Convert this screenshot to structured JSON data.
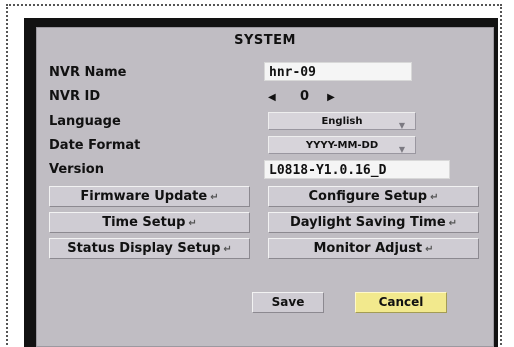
{
  "dialog": {
    "title": "SYSTEM"
  },
  "fields": {
    "nvr_name": {
      "label": "NVR Name",
      "value": "hnr-09"
    },
    "nvr_id": {
      "label": "NVR ID",
      "value": "0"
    },
    "language": {
      "label": "Language",
      "value": "English"
    },
    "date_format": {
      "label": "Date Format",
      "value": "YYYY-MM-DD"
    },
    "version": {
      "label": "Version",
      "value": "L0818-Y1.0.16_D"
    }
  },
  "buttons": {
    "firmware_update": "Firmware Update",
    "configure_setup": "Configure Setup",
    "time_setup": "Time Setup",
    "daylight_saving_time": "Daylight Saving Time",
    "status_display_setup": "Status Display Setup",
    "monitor_adjust": "Monitor Adjust",
    "save": "Save",
    "cancel": "Cancel"
  },
  "icons": {
    "enter": "↵",
    "left_arrow": "◀",
    "right_arrow": "▶",
    "dropdown": "▼"
  },
  "colors": {
    "panel_bg": "#c0bdc3",
    "cancel_highlight": "#f2e98d"
  }
}
